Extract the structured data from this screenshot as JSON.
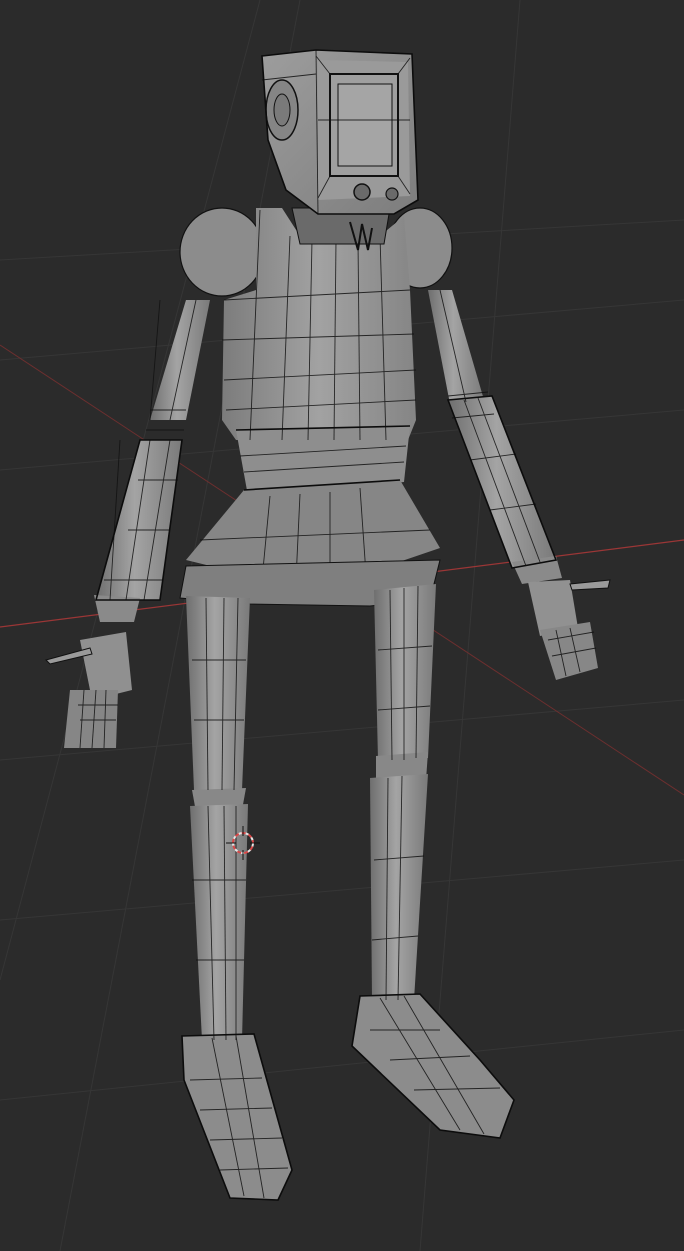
{
  "scene": {
    "editor": "3D Viewport",
    "shading_mode": "solid-wireframe",
    "object": "robot-character-mesh"
  },
  "colors": {
    "background": "#2b2b2b",
    "grid": "#3a3a3a",
    "x_axis": "#a33a3a",
    "mesh": "#8f8f8f",
    "mesh_light": "#a6a6a6",
    "mesh_dark": "#6e6e6e",
    "wire": "#111111",
    "cursor": "#d94848"
  },
  "icons": {
    "cursor": "3d-cursor-icon"
  }
}
